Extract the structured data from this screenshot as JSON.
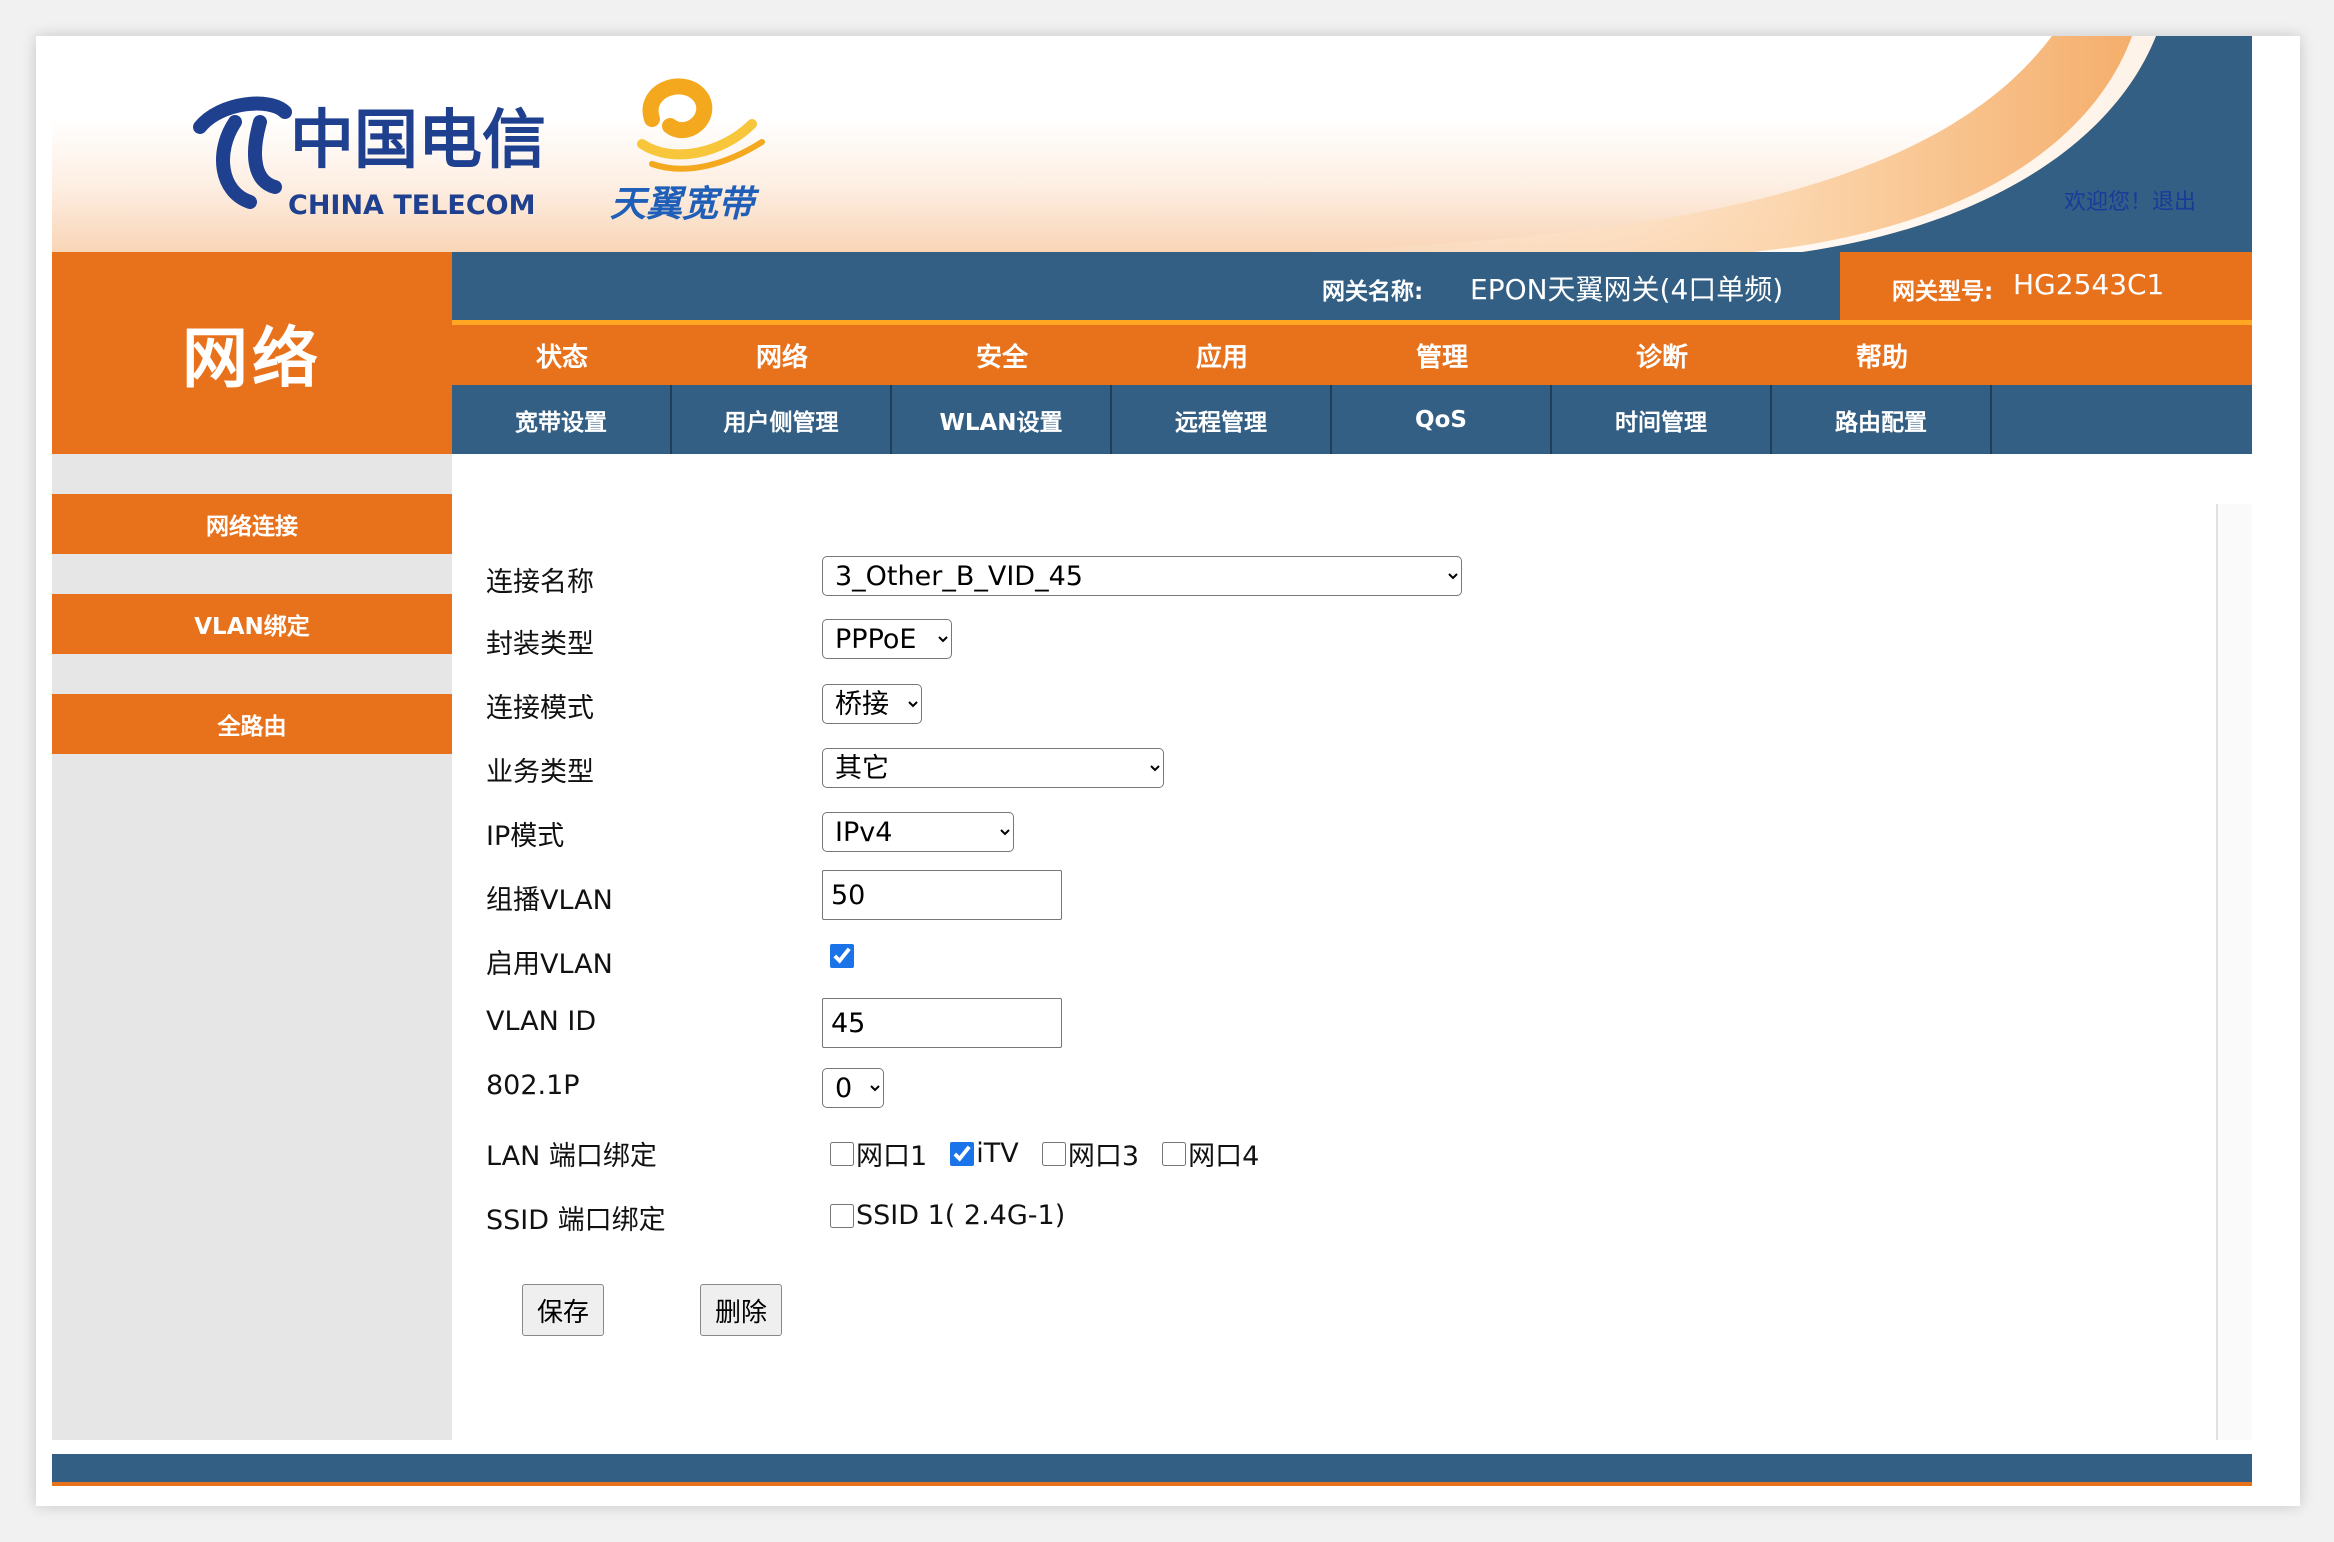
{
  "colors": {
    "orange": "#e8711c",
    "blue": "#335f84",
    "yellow": "#ffa623",
    "link": "#1a3a9a"
  },
  "brand": {
    "ct_name_cn": "中国电信",
    "ct_name_en": "CHINA TELECOM",
    "tianyi_text": "天翼宽带"
  },
  "welcome": {
    "text": "欢迎您！",
    "logout": "退出"
  },
  "section_title": "网络",
  "gateway": {
    "name_label": "网关名称:",
    "name_value": "EPON天翼网关(4口单频)",
    "model_label": "网关型号:",
    "model_value": "HG2543C1"
  },
  "main_nav": [
    "状态",
    "网络",
    "安全",
    "应用",
    "管理",
    "诊断",
    "帮助"
  ],
  "sub_nav": [
    "宽带设置",
    "用户侧管理",
    "WLAN设置",
    "远程管理",
    "QoS",
    "时间管理",
    "路由配置"
  ],
  "sidebar": [
    "网络连接",
    "VLAN绑定",
    "全路由"
  ],
  "form": {
    "connection_name": {
      "label": "连接名称",
      "value": "3_Other_B_VID_45"
    },
    "encapsulation": {
      "label": "封装类型",
      "value": "PPPoE"
    },
    "connection_mode": {
      "label": "连接模式",
      "value": "桥接"
    },
    "service_type": {
      "label": "业务类型",
      "value": "其它"
    },
    "ip_mode": {
      "label": "IP模式",
      "value": "IPv4"
    },
    "multicast_vlan": {
      "label": "组播VLAN",
      "value": "50"
    },
    "enable_vlan": {
      "label": "启用VLAN",
      "checked": true
    },
    "vlan_id": {
      "label": "VLAN ID",
      "value": "45"
    },
    "dot1p": {
      "label": "802.1P",
      "value": "0"
    },
    "lan_binding": {
      "label": "LAN 端口绑定",
      "ports": [
        {
          "label": "网口1",
          "checked": false
        },
        {
          "label": "iTV",
          "checked": true
        },
        {
          "label": "网口3",
          "checked": false
        },
        {
          "label": "网口4",
          "checked": false
        }
      ]
    },
    "ssid_binding": {
      "label": "SSID 端口绑定",
      "ports": [
        {
          "label": "SSID 1( 2.4G-1)",
          "checked": false
        }
      ]
    },
    "save_label": "保存",
    "delete_label": "删除"
  }
}
